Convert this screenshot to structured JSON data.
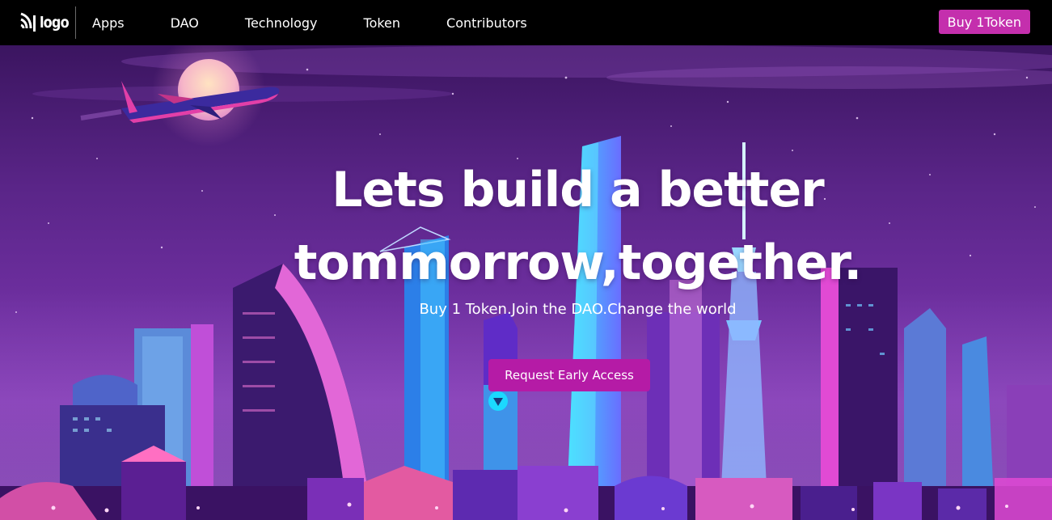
{
  "navbar": {
    "logo_text": "logo",
    "links": [
      "Apps",
      "DAO",
      "Technology",
      "Token",
      "Contributors"
    ],
    "buy_button": "Buy 1Token"
  },
  "hero": {
    "title_line1": "Lets build a better",
    "title_line2": "tommorrow,together.",
    "subtitle": "Buy 1 Token.Join the DAO.Change the world",
    "cta_button": "Request Early Access"
  },
  "colors": {
    "navbar_bg": "#000000",
    "accent": "#c42fad",
    "cta": "#b51ba6",
    "hero_sky": "#5a2588"
  }
}
